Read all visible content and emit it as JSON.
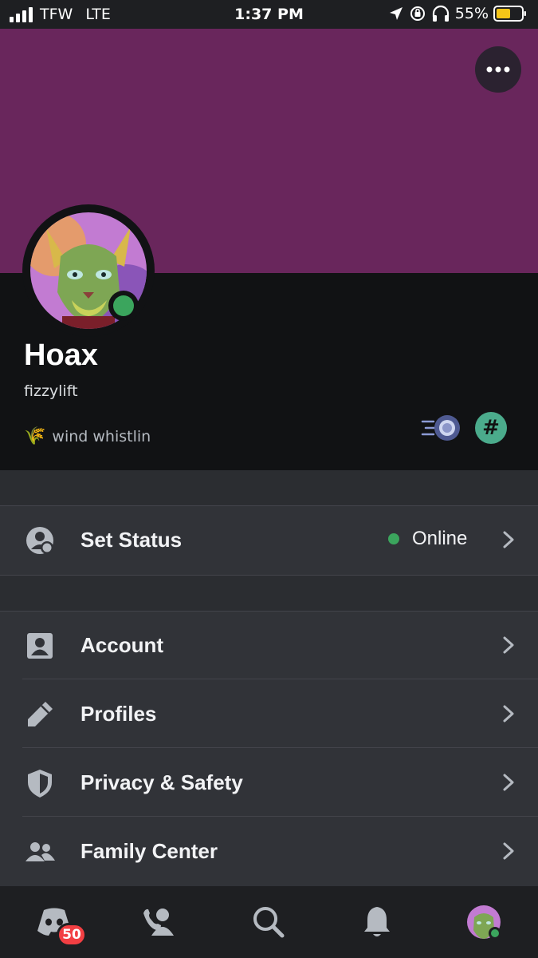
{
  "status_bar": {
    "carrier": "TFW",
    "network": "LTE",
    "time": "1:37 PM",
    "battery": "55%"
  },
  "profile": {
    "display_name": "Hoax",
    "username": "fizzylift",
    "custom_status_emoji": "🌾",
    "custom_status_text": "wind whistlin",
    "status_color": "#3ba55d",
    "banner_color": "#69265c",
    "badges": [
      "nitro-badge-icon",
      "hashtag-badge-icon"
    ]
  },
  "status_row": {
    "label": "Set Status",
    "value": "Online"
  },
  "settings": [
    {
      "label": "Account",
      "icon": "account-icon"
    },
    {
      "label": "Profiles",
      "icon": "pencil-icon"
    },
    {
      "label": "Privacy & Safety",
      "icon": "shield-icon"
    },
    {
      "label": "Family Center",
      "icon": "family-icon"
    }
  ],
  "tabs": [
    {
      "name": "servers",
      "icon": "discord-icon",
      "badge": "50"
    },
    {
      "name": "friends",
      "icon": "friends-icon"
    },
    {
      "name": "search",
      "icon": "search-icon"
    },
    {
      "name": "notifications",
      "icon": "bell-icon"
    },
    {
      "name": "you",
      "icon": "avatar"
    }
  ]
}
